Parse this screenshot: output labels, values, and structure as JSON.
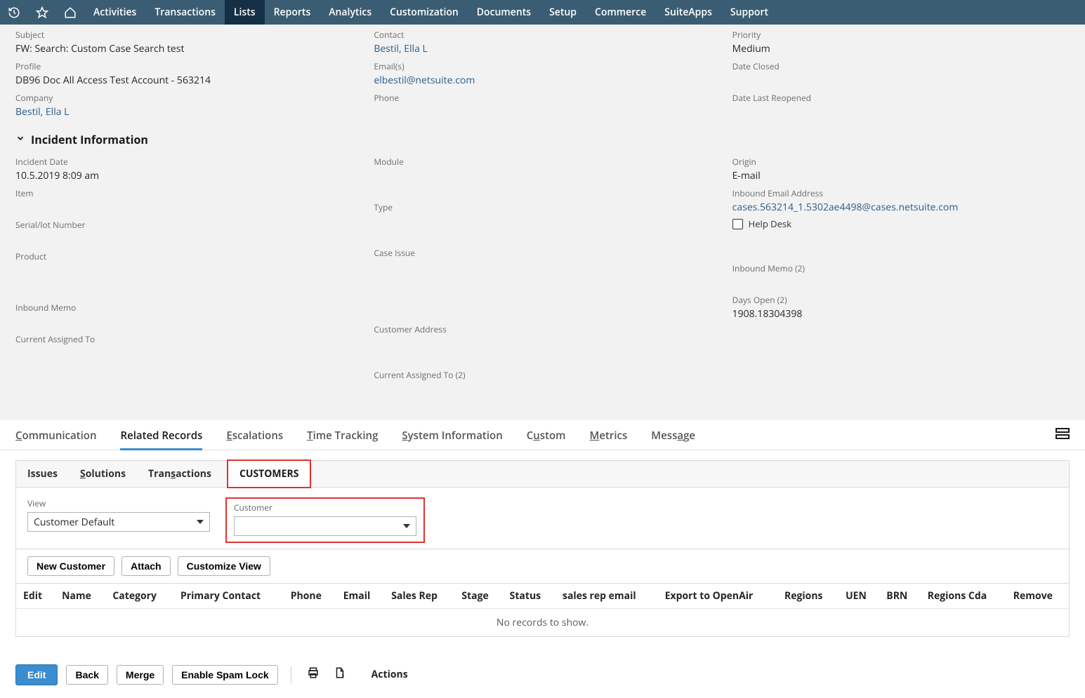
{
  "topnav": {
    "items": [
      "Activities",
      "Transactions",
      "Lists",
      "Reports",
      "Analytics",
      "Customization",
      "Documents",
      "Setup",
      "Commerce",
      "SuiteApps",
      "Support"
    ],
    "active": "Lists"
  },
  "primary": {
    "col1": [
      {
        "label": "Subject",
        "value": "FW: Search: Custom Case Search test"
      },
      {
        "label": "Profile",
        "value": "DB96 Doc All Access Test Account - 563214"
      },
      {
        "label": "Company",
        "link": "Bestil, Ella L"
      }
    ],
    "col2": [
      {
        "label": "Contact",
        "link": "Bestil, Ella L"
      },
      {
        "label": "Email(s)",
        "link": "elbestil@netsuite.com"
      },
      {
        "label": "Phone",
        "value": ""
      }
    ],
    "col3": [
      {
        "label": "Priority",
        "value": "Medium"
      },
      {
        "label": "Date Closed",
        "value": ""
      },
      {
        "label": "Date Last Reopened",
        "value": ""
      }
    ]
  },
  "incident": {
    "title": "Incident Information",
    "col1": [
      {
        "label": "Incident Date",
        "value": "10.5.2019 8:09 am"
      },
      {
        "label": "Item",
        "value": ""
      },
      {
        "label": "Serial/lot Number",
        "value": ""
      },
      {
        "label": "Product",
        "value": ""
      },
      {
        "label": "Inbound Memo",
        "value": ""
      },
      {
        "label": "Current Assigned To",
        "value": ""
      }
    ],
    "col2": [
      {
        "label": "Module",
        "value": ""
      },
      {
        "label": "Type",
        "value": ""
      },
      {
        "label": "Case Issue",
        "value": ""
      },
      {
        "label": "Customer Address",
        "value": ""
      },
      {
        "label": "Current Assigned To (2)",
        "value": ""
      }
    ],
    "col3": [
      {
        "label": "Origin",
        "value": "E-mail"
      },
      {
        "label": "Inbound Email Address",
        "link": "cases.563214_1.5302ae4498@cases.netsuite.com"
      },
      {
        "check": true,
        "label": "Help Desk"
      },
      {
        "label": "Inbound Memo (2)",
        "value": ""
      },
      {
        "label": "Days Open (2)",
        "value": "1908.18304398"
      }
    ]
  },
  "main_tabs": [
    {
      "label": "Communication",
      "u": "C"
    },
    {
      "label": "Related Records",
      "active": true
    },
    {
      "label": "Escalations",
      "u": "E"
    },
    {
      "label": "Time Tracking",
      "u": "T"
    },
    {
      "label": "System Information",
      "u": "S"
    },
    {
      "label": "Custom",
      "u": "u",
      "offset": 1
    },
    {
      "label": "Metrics",
      "u": "M"
    },
    {
      "label": "Message",
      "u": "a",
      "offset": 4
    }
  ],
  "sub_tabs": [
    "Issues",
    "Solutions",
    "Transactions",
    "CUSTOMERS"
  ],
  "sub_tabs_u": [
    "",
    "S",
    "s",
    ""
  ],
  "sub_active": "CUSTOMERS",
  "filters": {
    "view_label": "View",
    "view_value": "Customer Default",
    "customer_label": "Customer",
    "customer_value": ""
  },
  "buttons": {
    "new": "New Customer",
    "attach": "Attach",
    "customize": "Customize View"
  },
  "columns": [
    "Edit",
    "Name",
    "Category",
    "Primary Contact",
    "Phone",
    "Email",
    "Sales Rep",
    "Stage",
    "Status",
    "sales rep email",
    "Export to OpenAir",
    "Regions",
    "UEN",
    "BRN",
    "Regions Cda",
    "Remove"
  ],
  "empty_msg": "No records to show.",
  "bottom": {
    "edit": "Edit",
    "back": "Back",
    "merge": "Merge",
    "spam": "Enable Spam Lock",
    "actions": "Actions"
  }
}
